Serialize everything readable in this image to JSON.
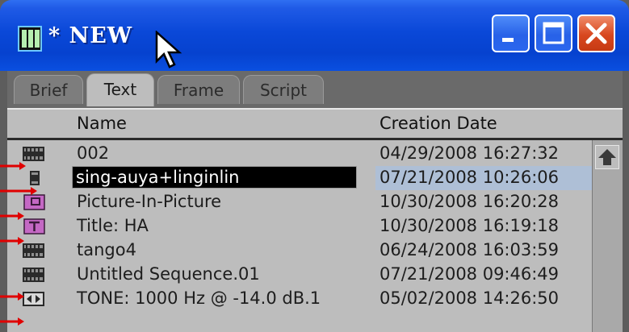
{
  "window": {
    "title": "* NEW"
  },
  "tabs": [
    {
      "label": "Brief",
      "active": false
    },
    {
      "label": "Text",
      "active": true
    },
    {
      "label": "Frame",
      "active": false
    },
    {
      "label": "Script",
      "active": false
    }
  ],
  "columns": {
    "name": "Name",
    "date": "Creation Date"
  },
  "rows": [
    {
      "icon": "sequence-icon",
      "name": "002",
      "date": "04/29/2008 16:27:32",
      "selected": false
    },
    {
      "icon": "subsequence-icon",
      "name": "sing-auya+linginlin",
      "date": "07/21/2008 10:26:06",
      "selected": true
    },
    {
      "icon": "pip-effect-icon",
      "name": "Picture-In-Picture",
      "date": "10/30/2008 16:20:28",
      "selected": false
    },
    {
      "icon": "title-effect-icon",
      "name": "Title: HA",
      "date": "10/30/2008 16:19:18",
      "selected": false
    },
    {
      "icon": "sequence-icon",
      "name": "tango4",
      "date": "06/24/2008 16:03:59",
      "selected": false
    },
    {
      "icon": "sequence-icon",
      "name": "Untitled Sequence.01",
      "date": "07/21/2008 09:46:49",
      "selected": false
    },
    {
      "icon": "tone-media-icon",
      "name": "TONE: 1000 Hz @ -14.0 dB.1",
      "date": "05/02/2008 14:26:50",
      "selected": false
    }
  ],
  "colors": {
    "titlebar": "#0a48d8",
    "close": "#d8471f",
    "panel": "#bdbdbd",
    "selection": "#aebfd6",
    "annotation_arrow": "#e00000"
  }
}
